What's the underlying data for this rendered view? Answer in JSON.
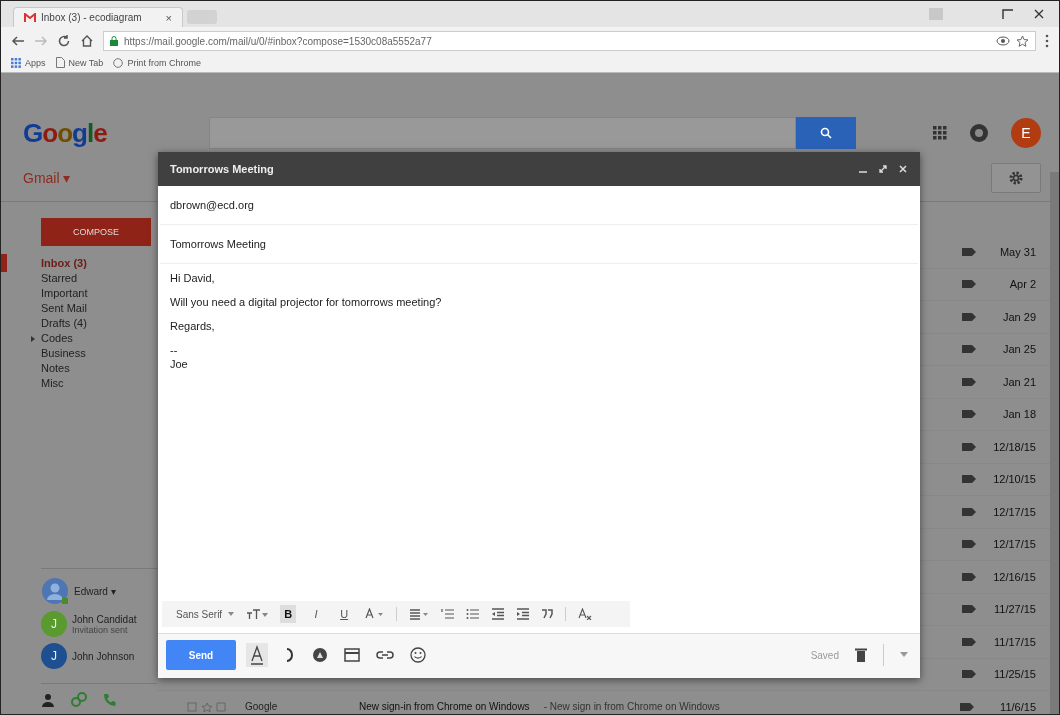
{
  "browser": {
    "tab_title": "Inbox (3) - ecodiagram",
    "tab_close": "×",
    "url": "https://mail.google.com/mail/u/0/#inbox?compose=1530c08a5552a77",
    "bookmarks": [
      {
        "kind": "apps",
        "label": "Apps"
      },
      {
        "kind": "page",
        "label": "New Tab"
      },
      {
        "kind": "google",
        "label": "Print from Chrome"
      }
    ]
  },
  "header": {
    "logo": "Google",
    "avatar": "E"
  },
  "gmail_menu": "Gmail ▾",
  "compose_button": "COMPOSE",
  "folders": [
    {
      "label": "Inbox (3)",
      "selected": true
    },
    {
      "label": "Starred",
      "selected": false
    },
    {
      "label": "Important",
      "selected": false
    },
    {
      "label": "Sent Mail",
      "selected": false
    },
    {
      "label": "Drafts (4)",
      "selected": false
    },
    {
      "label": "Codes",
      "selected": false,
      "expanded": false
    },
    {
      "label": "Business",
      "selected": false
    },
    {
      "label": "Notes",
      "selected": false
    },
    {
      "label": "Misc",
      "selected": false
    }
  ],
  "chat": {
    "me": "Edward ▾",
    "contacts": [
      {
        "name": "John Candidat",
        "status": "Invitation sent",
        "color": "#5a9a2e",
        "initial": "J"
      },
      {
        "name": "John Johnson",
        "color": "#1e4f91",
        "initial": "J"
      }
    ]
  },
  "dates": [
    "May 31",
    "Apr 2",
    "Jan 29",
    "Jan 25",
    "Jan 21",
    "Jan 18",
    "12/18/15",
    "12/10/15",
    "12/17/15",
    "12/17/15",
    "12/16/15",
    "11/27/15",
    "11/17/15",
    "11/25/15"
  ],
  "bottom_row": {
    "sender": "Google",
    "subject": "New sign-in from Chrome on Windows",
    "snippet": "- New sign in from Chrome on Windows",
    "date": "11/6/15"
  },
  "compose": {
    "title": "Tomorrows Meeting",
    "to": "dbrown@ecd.org",
    "subject": "Tomorrows Meeting",
    "body": [
      "Hi David,",
      "Will you need a digital projector for tomorrows meeting?",
      "Regards,",
      "--",
      "Joe"
    ],
    "toolbar": {
      "font": "Sans Serif",
      "bold": "B",
      "bold_on": true,
      "italic": "I",
      "underline": "U"
    },
    "send": "Send",
    "saved": "Saved"
  }
}
